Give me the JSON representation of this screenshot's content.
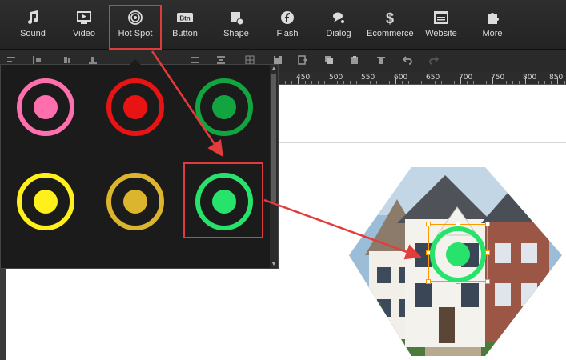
{
  "toolbar": {
    "items": [
      {
        "label": "Sound",
        "icon": "music-note-icon"
      },
      {
        "label": "Video",
        "icon": "video-icon"
      },
      {
        "label": "Hot Spot",
        "icon": "hotspot-icon"
      },
      {
        "label": "Button",
        "icon": "button-icon",
        "icon_text": "Btn"
      },
      {
        "label": "Shape",
        "icon": "shape-icon"
      },
      {
        "label": "Flash",
        "icon": "flash-icon"
      },
      {
        "label": "Dialog",
        "icon": "dialog-icon"
      },
      {
        "label": "Ecommerce",
        "icon": "dollar-icon",
        "icon_text": "$"
      },
      {
        "label": "Website",
        "icon": "website-icon"
      },
      {
        "label": "More",
        "icon": "puzzle-icon"
      }
    ],
    "highlighted": "Hot Spot"
  },
  "ruler": {
    "labels": [
      "450",
      "500",
      "550",
      "600",
      "650",
      "700",
      "750",
      "800",
      "850"
    ]
  },
  "hotspot_styles": [
    {
      "name": "pink",
      "ring": "#ff6fae",
      "dot": "#ff6fae"
    },
    {
      "name": "red",
      "ring": "#e81414",
      "dot": "#e81414"
    },
    {
      "name": "dark-green",
      "ring": "#12a43e",
      "dot": "#12a43e"
    },
    {
      "name": "yellow",
      "ring": "#ffef1a",
      "dot": "#ffef1a"
    },
    {
      "name": "gold",
      "ring": "#dbb52d",
      "dot": "#dbb52d"
    },
    {
      "name": "bright-green",
      "ring": "#27e36b",
      "dot": "#27e36b",
      "selected": true
    }
  ],
  "colors": {
    "highlight": "#e03b3b",
    "selection": "#ff9900",
    "toolbar_bg": "#2a2a2a",
    "canvas": "#ffffff"
  }
}
